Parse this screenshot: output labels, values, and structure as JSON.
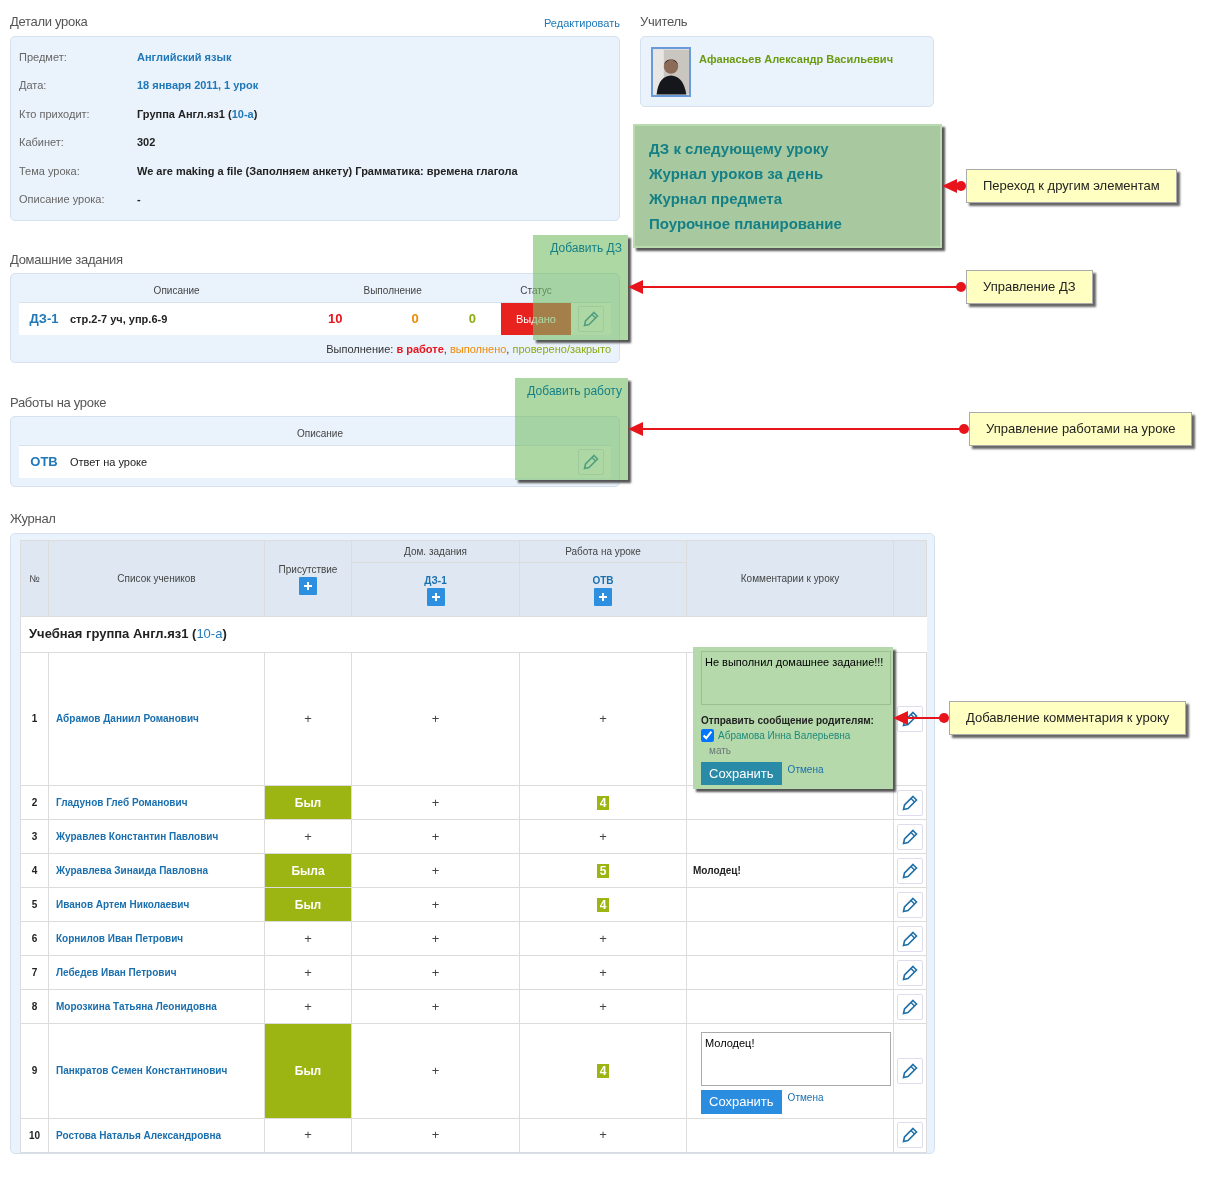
{
  "lesson_details": {
    "title": "Детали урока",
    "edit_link": "Редактировать",
    "fields": [
      {
        "label": "Предмет:",
        "value": "Английский язык",
        "kind": "link"
      },
      {
        "label": "Дата:",
        "value": "18 января 2011, 1 урок",
        "kind": "link"
      },
      {
        "label": "Кто приходит:",
        "value": "Группа Англ.яз1 (",
        "link": "10-а",
        "suffix": ")",
        "kind": "group"
      },
      {
        "label": "Кабинет:",
        "value": "302",
        "kind": "text"
      },
      {
        "label": "Тема урока:",
        "value": "We are making a file (Заполняем анкету) Грамматика: времена глагола",
        "kind": "text"
      },
      {
        "label": "Описание урока:",
        "value": "-",
        "kind": "text"
      }
    ]
  },
  "teacher": {
    "title": "Учитель",
    "name": "Афанасьев Александр Васильевич"
  },
  "quick_links": [
    "ДЗ к следующему уроку",
    "Журнал уроков за день",
    "Журнал предмета",
    "Поурочное планирование"
  ],
  "homework": {
    "title": "Домашние задания",
    "add_button": "Добавить ДЗ",
    "columns": [
      "Описание",
      "Выполнение",
      "Статус"
    ],
    "rows": [
      {
        "code": "ДЗ-1",
        "description": "стр.2-7 уч, упр.6-9",
        "counts": [
          "10",
          "0",
          "0"
        ],
        "status": "Выдано"
      }
    ],
    "legend": {
      "label": "Выполнение:",
      "separator": ",",
      "items": [
        {
          "text": "в работе",
          "color": "#e8141c"
        },
        {
          "text": "выполнено",
          "color": "#f08a00"
        },
        {
          "text": "проверено/закрыто",
          "color": "#8aab12"
        }
      ]
    }
  },
  "lesson_works": {
    "title": "Работы на уроке",
    "add_button": "Добавить работу",
    "columns": [
      "Описание"
    ],
    "rows": [
      {
        "code": "ОТВ",
        "description": "Ответ на уроке"
      }
    ]
  },
  "journal": {
    "title": "Журнал",
    "columns": {
      "number": "№",
      "students": "Список учеников",
      "attendance": "Присутствие",
      "homework": "Дом. задания",
      "homework_items": [
        "ДЗ-1"
      ],
      "work": "Работа на уроке",
      "work_items": [
        "ОТВ"
      ],
      "comments": "Комментарии к уроку"
    },
    "group": {
      "label": "Учебная группа Англ.яз1 (",
      "link": "10-а",
      "suffix": ")"
    },
    "students": [
      {
        "number": "1",
        "name": "Абрамов Даниил Романович",
        "attendance": {
          "text": "+",
          "present": false
        },
        "homework": "+",
        "work": {
          "text": "+",
          "graded": false
        },
        "editor": {
          "text": "Не выполнил домашнее задание!!!",
          "notify_label": "Отправить сообщение родителям:",
          "parents": [
            {
              "name": "Абрамова Инна Валерьевна",
              "relation": "мать",
              "checked": true
            }
          ],
          "save": "Сохранить",
          "cancel": "Отмена",
          "highlighted": true
        }
      },
      {
        "number": "2",
        "name": "Гладунов Глеб Романович",
        "attendance": {
          "text": "Был",
          "present": true
        },
        "homework": "+",
        "work": {
          "text": "4",
          "graded": true
        }
      },
      {
        "number": "3",
        "name": "Журавлев Константин Павлович",
        "attendance": {
          "text": "+",
          "present": false
        },
        "homework": "+",
        "work": {
          "text": "+",
          "graded": false
        }
      },
      {
        "number": "4",
        "name": "Журавлева Зинаида Павловна",
        "attendance": {
          "text": "Была",
          "present": true
        },
        "homework": "+",
        "work": {
          "text": "5",
          "graded": true
        },
        "comment": "Молодец!"
      },
      {
        "number": "5",
        "name": "Иванов Артем Николаевич",
        "attendance": {
          "text": "Был",
          "present": true
        },
        "homework": "+",
        "work": {
          "text": "4",
          "graded": true
        }
      },
      {
        "number": "6",
        "name": "Корнилов Иван Петрович",
        "attendance": {
          "text": "+",
          "present": false
        },
        "homework": "+",
        "work": {
          "text": "+",
          "graded": false
        }
      },
      {
        "number": "7",
        "name": "Лебедев Иван Петрович",
        "attendance": {
          "text": "+",
          "present": false
        },
        "homework": "+",
        "work": {
          "text": "+",
          "graded": false
        }
      },
      {
        "number": "8",
        "name": "Морозкина Татьяна Леонидовна",
        "attendance": {
          "text": "+",
          "present": false
        },
        "homework": "+",
        "work": {
          "text": "+",
          "graded": false
        }
      },
      {
        "number": "9",
        "name": "Панкратов Семен Константинович",
        "attendance": {
          "text": "Был",
          "present": true
        },
        "homework": "+",
        "work": {
          "text": "4",
          "graded": true
        },
        "editor": {
          "text": "Молодец!",
          "save": "Сохранить",
          "cancel": "Отмена",
          "highlighted": false
        }
      },
      {
        "number": "10",
        "name": "Ростова Наталья Александровна",
        "attendance": {
          "text": "+",
          "present": false
        },
        "homework": "+",
        "work": {
          "text": "+",
          "graded": false
        }
      }
    ]
  },
  "callouts": [
    {
      "text": "Переход к другим элементам"
    },
    {
      "text": "Управление ДЗ"
    },
    {
      "text": "Управление работами на уроке"
    },
    {
      "text": "Добавление комментария к уроку"
    }
  ]
}
